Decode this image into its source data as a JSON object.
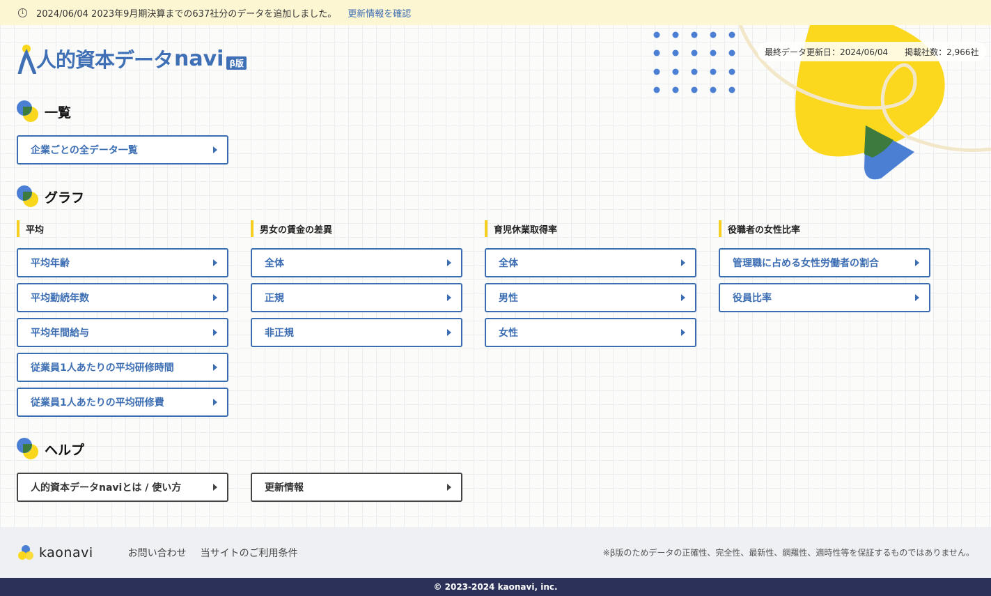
{
  "notice": {
    "message": "2024/06/04 2023年9月期決算までの637社分のデータを追加しました。",
    "link": "更新情報を確認"
  },
  "logo": {
    "text": "人的資本データ",
    "navi": "navi",
    "beta": "β版"
  },
  "status": {
    "last_updated": "最終データ更新日：2024/06/04",
    "company_count": "掲載社数：2,966社"
  },
  "sections": {
    "list": {
      "title": "一覧",
      "buttons": [
        "企業ごとの全データ一覧"
      ]
    },
    "graph": {
      "title": "グラフ",
      "columns": [
        {
          "heading": "平均",
          "buttons": [
            "平均年齢",
            "平均勤続年数",
            "平均年間給与",
            "従業員1人あたりの平均研修時間",
            "従業員1人あたりの平均研修費"
          ]
        },
        {
          "heading": "男女の賃金の差異",
          "buttons": [
            "全体",
            "正規",
            "非正規"
          ]
        },
        {
          "heading": "育児休業取得率",
          "buttons": [
            "全体",
            "男性",
            "女性"
          ]
        },
        {
          "heading": "役職者の女性比率",
          "buttons": [
            "管理職に占める女性労働者の割合",
            "役員比率"
          ]
        }
      ]
    },
    "help": {
      "title": "ヘルプ",
      "buttons": [
        "人的資本データnaviとは / 使い方",
        "更新情報"
      ]
    }
  },
  "footer": {
    "brand": "kaonavi",
    "links": [
      "お問い合わせ",
      "当サイトのご利用条件"
    ],
    "disclaimer": "※β版のためデータの正確性、完全性、最新性、網羅性、適時性等を保証するものではありません。",
    "copyright": "© 2023-2024 kaonavi, inc."
  },
  "colors": {
    "accent_blue": "#3b6db3",
    "accent_yellow": "#f9d71c",
    "footer_dark": "#2b3158"
  },
  "icons": [
    "info-icon",
    "arrow-right-icon",
    "section-mark-icon",
    "kaonavi-logo-icon"
  ]
}
